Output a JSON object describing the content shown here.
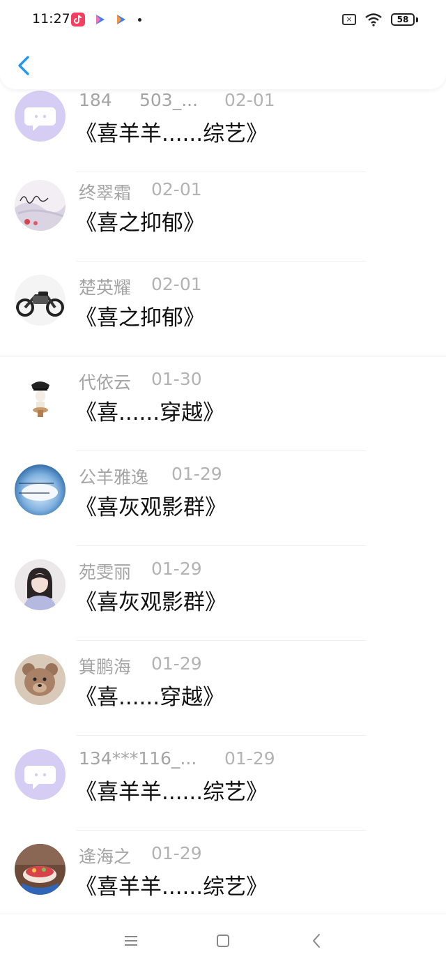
{
  "status_bar": {
    "time": "11:27",
    "battery": "58",
    "icons": [
      "tiktok-icon",
      "video-app-icon",
      "video-app-icon",
      "sim-off-icon",
      "wifi-icon",
      "battery-icon"
    ]
  },
  "header": {
    "back_icon": "chevron-left-icon"
  },
  "items": [
    {
      "name": "184",
      "name_extra": "503_...",
      "date": "02-01",
      "message": "《喜羊羊......综艺》",
      "avatar": "chat-bubble-avatar"
    },
    {
      "name": "终翠霜",
      "date": "02-01",
      "message": "《喜之抑郁》",
      "avatar": "signature-photo-avatar"
    },
    {
      "name": "楚英耀",
      "date": "02-01",
      "message": "《喜之抑郁》",
      "avatar": "motorcycle-photo-avatar"
    },
    {
      "name": "代依云",
      "date": "01-30",
      "message": "《喜......穿越》",
      "avatar": "police-figure-avatar"
    },
    {
      "name": "公羊雅逸",
      "date": "01-29",
      "message": "《喜灰观影群》",
      "avatar": "sky-text-avatar"
    },
    {
      "name": "苑雯丽",
      "date": "01-29",
      "message": "《喜灰观影群》",
      "avatar": "girl-photo-avatar"
    },
    {
      "name": "箕鹏海",
      "date": "01-29",
      "message": "《喜......穿越》",
      "avatar": "teddy-bear-avatar"
    },
    {
      "name": "134***116_...",
      "date": "01-29",
      "message": "《喜羊羊......综艺》",
      "avatar": "chat-bubble-avatar"
    },
    {
      "name": "逄海之",
      "date": "01-29",
      "message": "《喜羊羊......综艺》",
      "avatar": "cake-photo-avatar"
    }
  ],
  "nav": [
    "menu-icon",
    "home-square-icon",
    "back-triangle-icon"
  ],
  "colors": {
    "accent_blue": "#2196f3",
    "name_gray": "#a4a4a4",
    "message_black": "#111111",
    "default_avatar_bg": "#d6cdf5"
  }
}
